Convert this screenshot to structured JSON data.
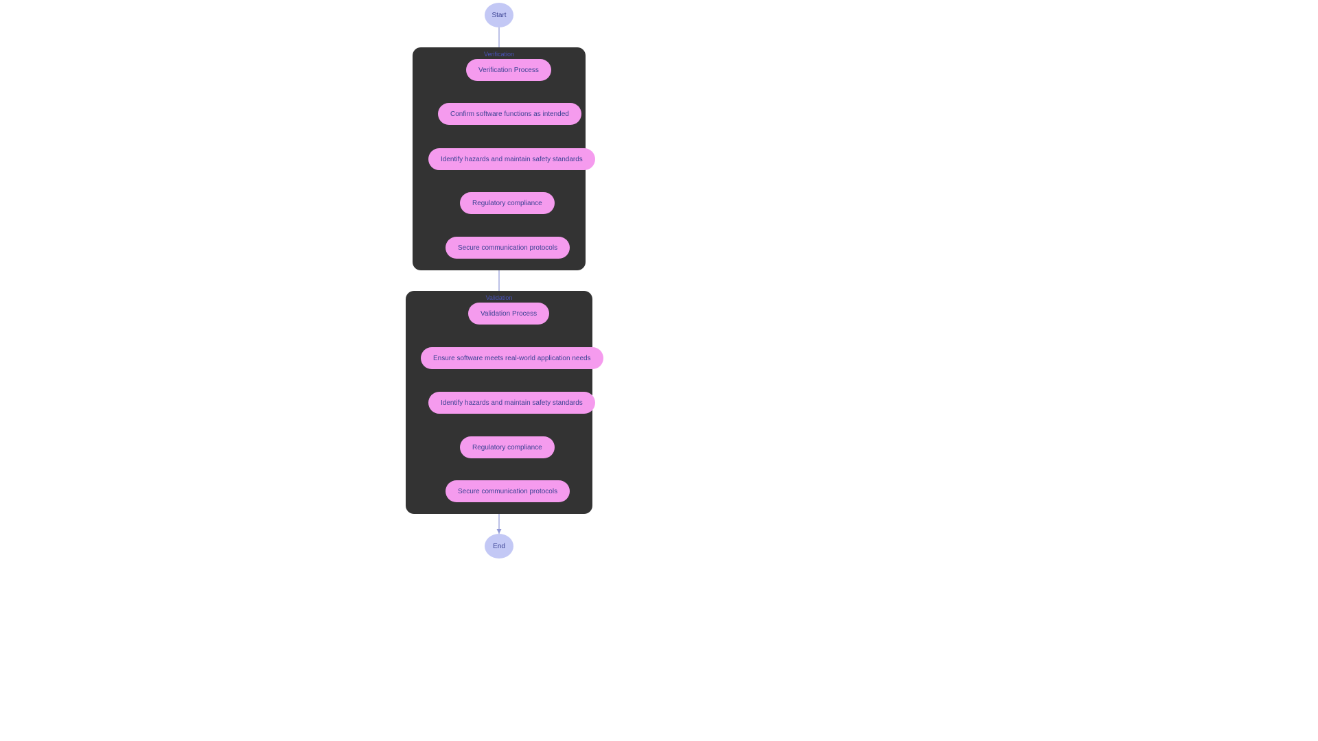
{
  "start": "Start",
  "end": "End",
  "group1": {
    "label": "Verification",
    "nodes": [
      "Verification Process",
      "Confirm software functions as intended",
      "Identify hazards and maintain safety standards",
      "Regulatory compliance",
      "Secure communication protocols"
    ]
  },
  "group2": {
    "label": "Validation",
    "nodes": [
      "Validation Process",
      "Ensure software meets real-world application needs",
      "Identify hazards and maintain safety standards",
      "Regulatory compliance",
      "Secure communication protocols"
    ]
  }
}
